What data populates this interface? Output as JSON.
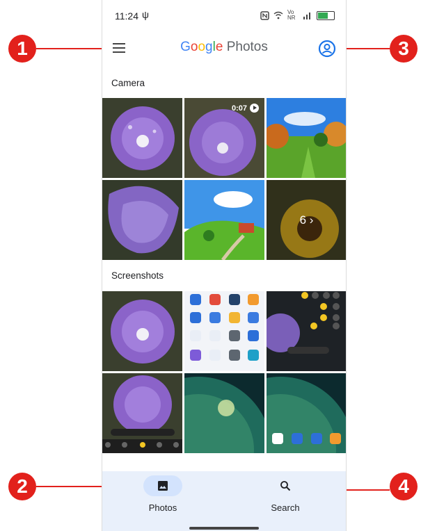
{
  "status_bar": {
    "time": "11:24",
    "usb_symbol": "ψ",
    "network_label": "Vo NR"
  },
  "top_bar": {
    "logo": {
      "g": "G",
      "o1": "o",
      "o2": "o",
      "g2": "g",
      "l": "l",
      "e": "e",
      "product": "Photos"
    }
  },
  "sections": [
    {
      "label": "Camera",
      "tiles": [
        {
          "kind": "flower"
        },
        {
          "kind": "flower",
          "video_duration": "0:07"
        },
        {
          "kind": "park"
        },
        {
          "kind": "flower-close"
        },
        {
          "kind": "meadow"
        },
        {
          "kind": "sunflower",
          "more_count": "6"
        }
      ]
    },
    {
      "label": "Screenshots",
      "tiles": [
        {
          "kind": "flower"
        },
        {
          "kind": "app-grid"
        },
        {
          "kind": "camera-settings"
        },
        {
          "kind": "flower-camera"
        },
        {
          "kind": "planet"
        },
        {
          "kind": "planet-dock"
        }
      ]
    }
  ],
  "more_arrow": "›",
  "bottom_nav": {
    "photos_label": "Photos",
    "search_label": "Search"
  },
  "callouts": [
    "1",
    "2",
    "3",
    "4"
  ],
  "colors": {
    "accent": "#1a73e8",
    "nav_bg": "#e9f0fb",
    "callout": "#e2211c"
  }
}
